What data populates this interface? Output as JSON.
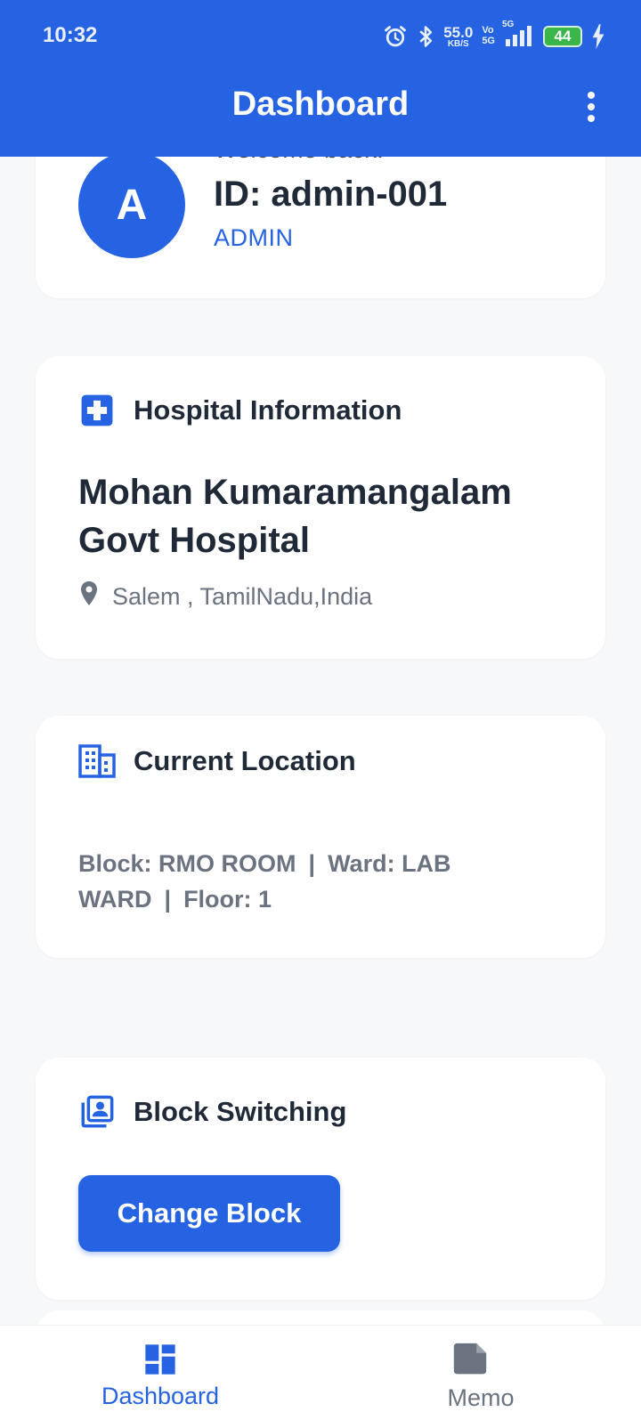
{
  "status_bar": {
    "time": "10:32",
    "net_speed_value": "55.0",
    "net_speed_unit": "KB/S",
    "volte_top": "Vo",
    "volte_bottom": "5G",
    "network_type": "5G",
    "battery_level": "44",
    "icons": [
      "alarm-icon",
      "bluetooth-icon",
      "signal-icon",
      "battery-icon",
      "charging-icon"
    ]
  },
  "app_bar": {
    "title": "Dashboard",
    "menu_icon": "more-vert-icon"
  },
  "profile": {
    "avatar_initial": "A",
    "welcome_text": "Welcome back!",
    "user_id": "ID: admin-001",
    "role": "ADMIN"
  },
  "hospital": {
    "section_title": "Hospital Information",
    "name": "Mohan Kumaramangalam Govt Hospital",
    "address": "Salem , TamilNadu,India",
    "icon": "hospital-cross-icon"
  },
  "current_location": {
    "section_title": "Current Location",
    "block": "Block: RMO ROOM",
    "ward": "Ward: LAB WARD",
    "floor": "Floor: 1",
    "separator": "|",
    "icon": "building-icon"
  },
  "block_switching": {
    "section_title": "Block Switching",
    "button_label": "Change Block",
    "icon": "switch-account-icon"
  },
  "bottom_nav": {
    "items": [
      {
        "label": "Dashboard",
        "icon": "dashboard-icon",
        "active": true
      },
      {
        "label": "Memo",
        "icon": "memo-icon",
        "active": false
      }
    ]
  },
  "colors": {
    "primary": "#2563e3",
    "background": "#f7f8fa",
    "card": "#ffffff",
    "text_dark": "#1f2937",
    "text_muted": "#6b7280",
    "battery": "#39b54a"
  }
}
